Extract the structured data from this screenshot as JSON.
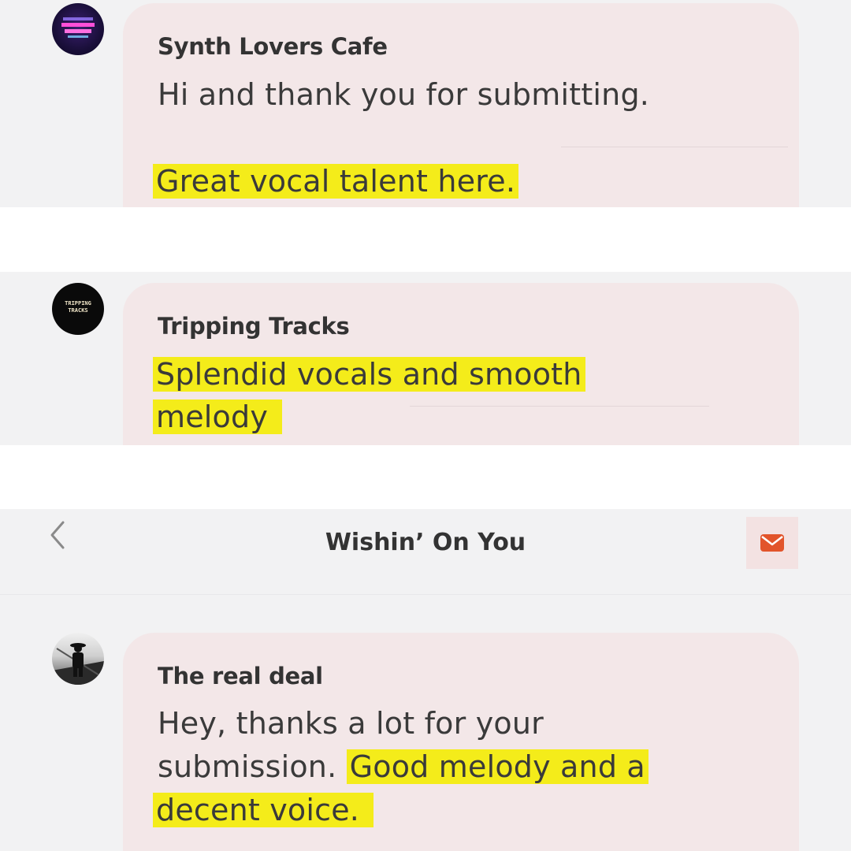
{
  "screens": [
    {
      "sender": "Synth Lovers Cafe",
      "message": "Hi and thank you for submitting.",
      "highlight": "Great vocal talent here.",
      "avatar_colors": {
        "bg": "#1a0f3a",
        "glow": "#ff4fd8"
      }
    },
    {
      "sender": "Tripping Tracks",
      "highlight_line1": "Splendid vocals and smooth",
      "highlight_line2": "melody",
      "avatar_text_1": "TRIPPING",
      "avatar_text_2": "TRACKS"
    },
    {
      "header": {
        "back_icon": "chevron-left-icon",
        "title": "Wishin’ On You",
        "mail_icon": "envelope-icon",
        "accent": "#e2542b"
      },
      "sender": "The real deal",
      "message_line1": "Hey, thanks a lot for your",
      "message_line2_plain": "submission.",
      "highlight_line2": "Good melody and a",
      "highlight_line3": "decent voice."
    }
  ],
  "colors": {
    "highlight": "#f4ec1a",
    "bubble": "#f3e7e8",
    "panel": "#f2f2f3"
  }
}
